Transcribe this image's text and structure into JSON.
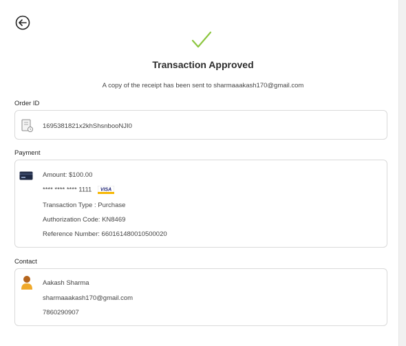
{
  "header": {
    "title": "Transaction Approved",
    "receipt_note": "A copy of the receipt has been sent to sharmaaakash170@gmail.com"
  },
  "order": {
    "label": "Order ID",
    "id": "1695381821x2khShsnbooNJI0"
  },
  "payment": {
    "label": "Payment",
    "amount": "Amount: $100.00",
    "card_number": "**** **** **** 1111",
    "card_brand": "VISA",
    "transaction_type": "Transaction Type : Purchase",
    "authorization_code": "Authorization Code: KN8469",
    "reference_number": "Reference Number: 660161480010500020"
  },
  "contact": {
    "label": "Contact",
    "name": "Aakash Sharma",
    "email": "sharmaaakash170@gmail.com",
    "phone": "7860290907"
  },
  "colors": {
    "success_check": "#8cc63f",
    "avatar": "#f0a92b",
    "visa_blue": "#1a1f71",
    "visa_gold": "#f7b600"
  }
}
